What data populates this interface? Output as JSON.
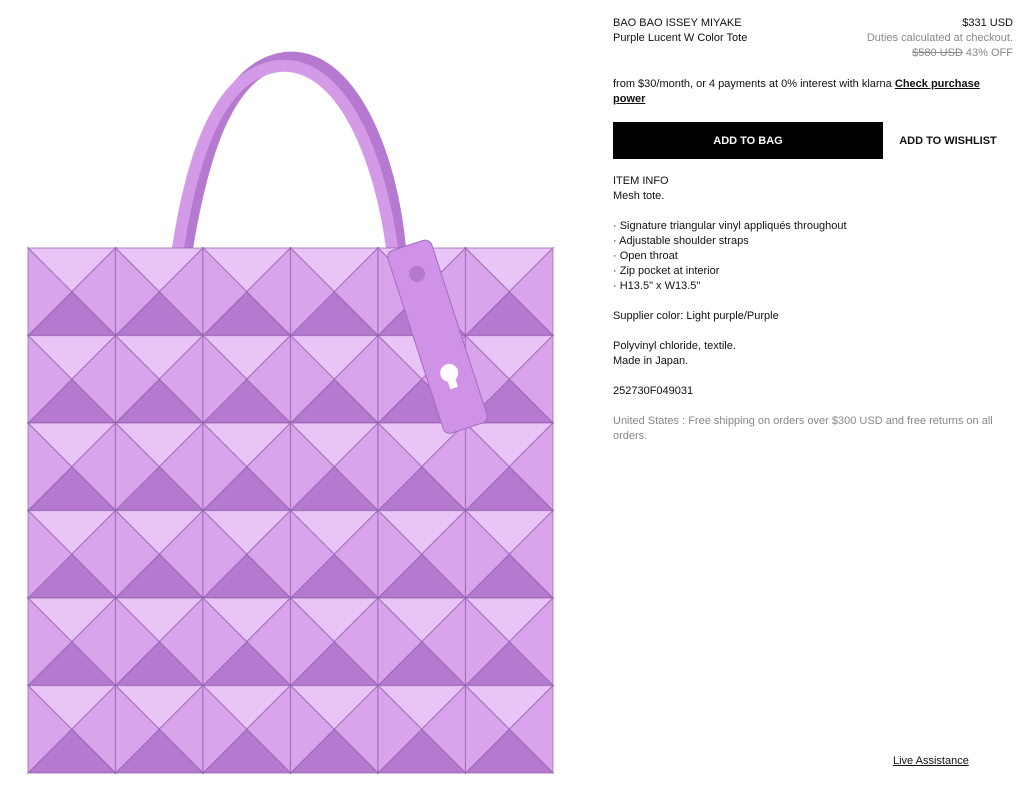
{
  "product": {
    "brand": "BAO BAO ISSEY MIYAKE",
    "name": "Purple Lucent W Color Tote",
    "price": "$331 USD",
    "duties_note": "Duties calculated at checkout.",
    "original_price": "$580 USD",
    "discount": "43% OFF"
  },
  "klarna": {
    "text": "from $30/month, or 4 payments at 0% interest with klarna",
    "link": "Check purchase power"
  },
  "actions": {
    "add_to_bag": "ADD TO BAG",
    "add_to_wishlist": "ADD TO WISHLIST"
  },
  "item_info": {
    "heading": "ITEM INFO",
    "summary": "Mesh tote.",
    "features": [
      "· Signature triangular vinyl appliqués throughout",
      "· Adjustable shoulder straps",
      "· Open throat",
      "· Zip pocket at interior",
      "· H13.5\" x W13.5\""
    ],
    "supplier_color": "Supplier color: Light purple/Purple",
    "material": "Polyvinyl chloride, textile.",
    "origin": "Made in Japan.",
    "sku": "252730F049031"
  },
  "shipping": "United States : Free shipping on orders over $300 USD and free returns on all orders.",
  "live_assistance": "Live Assistance",
  "image": {
    "alt": "Purple Lucent W Color Tote",
    "colors": {
      "bag": "#d9a4ec",
      "bag_dark": "#b57ad0",
      "bag_light": "#e9c4f6",
      "grid": "#8c5aa8"
    }
  }
}
